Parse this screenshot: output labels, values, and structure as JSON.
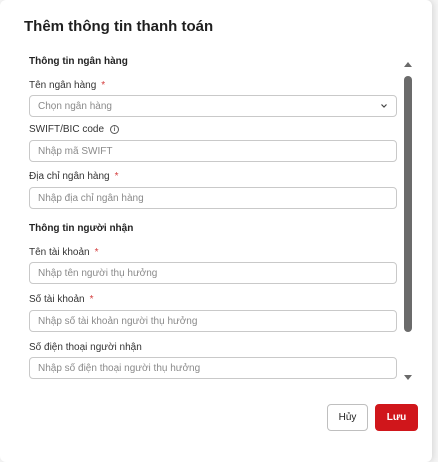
{
  "modal": {
    "title": "Thêm thông tin thanh toán"
  },
  "bank_section": {
    "title": "Thông tin ngân hàng",
    "bank_name": {
      "label": "Tên ngân hàng",
      "required_mark": "*",
      "placeholder": "Chọn ngân hàng",
      "value": ""
    },
    "swift": {
      "label": "SWIFT/BIC code",
      "info_icon": "i",
      "placeholder": "Nhập mã SWIFT",
      "value": ""
    },
    "bank_address": {
      "label": "Địa chỉ ngân hàng",
      "required_mark": "*",
      "placeholder": "Nhập địa chỉ ngân hàng",
      "value": ""
    }
  },
  "recipient_section": {
    "title": "Thông tin người nhận",
    "account_name": {
      "label": "Tên tài khoản",
      "required_mark": "*",
      "placeholder": "Nhập tên người thụ hưởng",
      "value": ""
    },
    "account_number": {
      "label": "Số tài khoản",
      "required_mark": "*",
      "placeholder": "Nhập số tài khoản người thụ hưởng",
      "value": ""
    },
    "phone": {
      "label": "Số điện thoại người nhận",
      "placeholder": "Nhập số điện thoại người thụ hưởng",
      "value": ""
    }
  },
  "footer": {
    "cancel_label": "Hủy",
    "save_label": "Lưu"
  },
  "colors": {
    "primary": "#d0161b",
    "required": "#d43b3b",
    "border": "#c9c9c9"
  },
  "icons": {
    "select_chevron": "chevron-down-icon",
    "swift_info": "info-icon",
    "scroll_up": "arrow-up-icon",
    "scroll_down": "arrow-down-icon"
  }
}
